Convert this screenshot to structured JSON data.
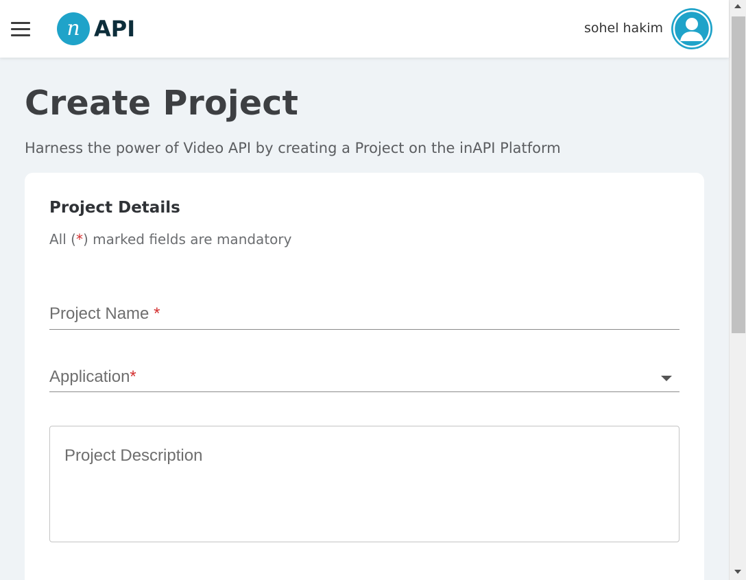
{
  "header": {
    "logo_mark": "n",
    "logo_text": "API",
    "user_name": "sohel hakim",
    "menu_icon": "hamburger-menu-icon",
    "avatar_icon": "user-avatar-icon"
  },
  "page": {
    "title": "Create Project",
    "subtitle": "Harness the power of Video API by creating a Project on the inAPI Platform"
  },
  "card": {
    "title": "Project Details",
    "note_prefix": "All (",
    "note_star": "*",
    "note_suffix": ") marked fields are mandatory"
  },
  "form": {
    "project_name": {
      "label": "Project Name",
      "required_mark": "*",
      "value": ""
    },
    "application": {
      "label": "Application",
      "required_mark": "*",
      "value": ""
    },
    "description": {
      "placeholder": "Project Description",
      "value": ""
    }
  },
  "colors": {
    "brand": "#1fa3c9",
    "required": "#d32f2f",
    "page_bg": "#eff3f6"
  }
}
